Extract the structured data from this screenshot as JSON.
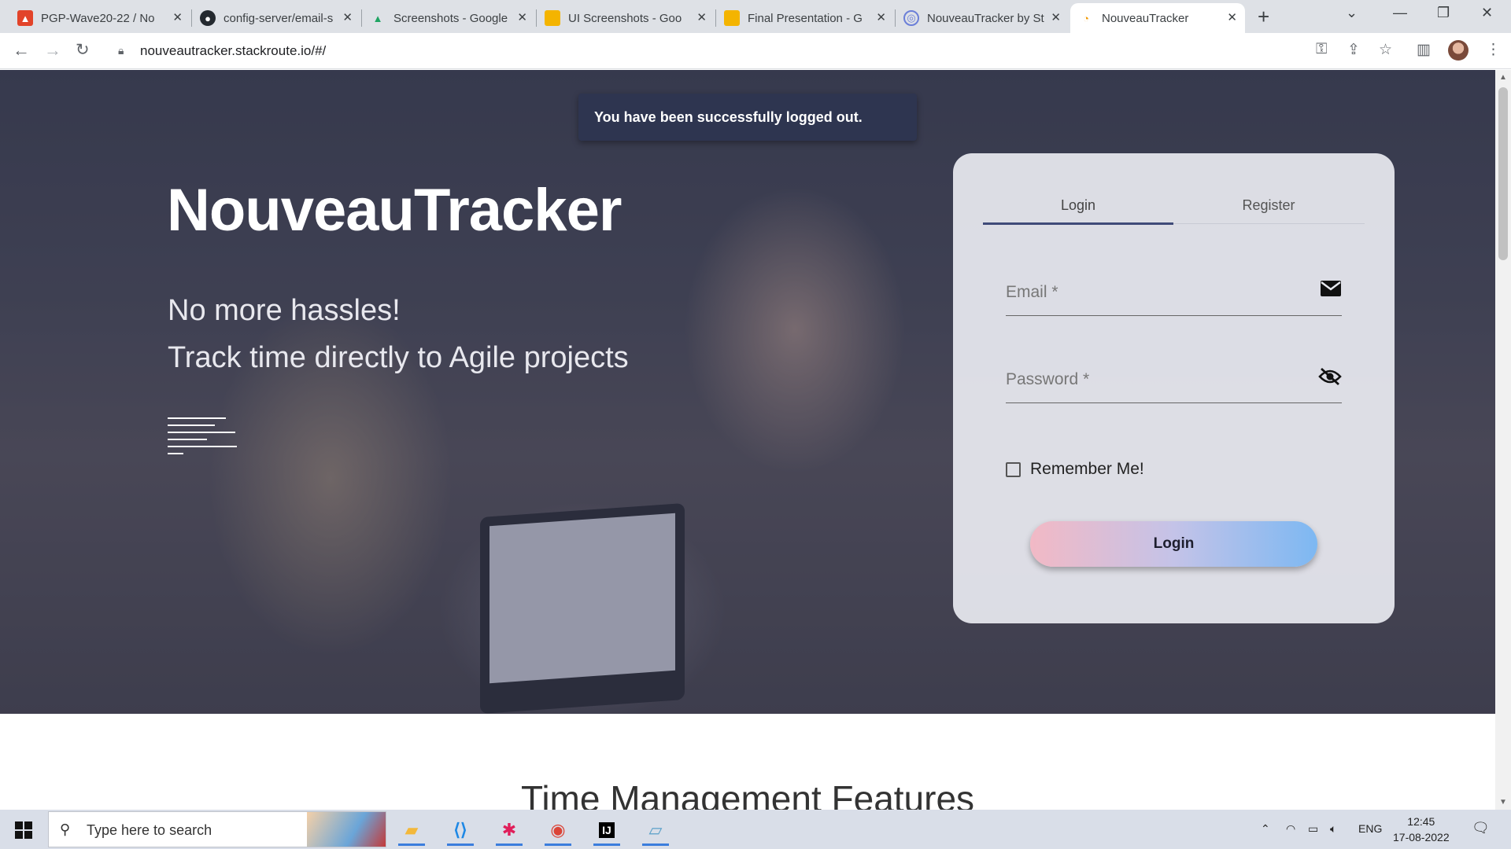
{
  "browser": {
    "tabs": [
      {
        "label": "PGP-Wave20-22 / No",
        "icon": "gitlab-icon",
        "color": "#e24329"
      },
      {
        "label": "config-server/email-s",
        "icon": "github-icon",
        "color": "#24292f"
      },
      {
        "label": "Screenshots - Google",
        "icon": "google-drive-icon",
        "color": "#1fa463"
      },
      {
        "label": "UI Screenshots - Goo",
        "icon": "google-slides-icon",
        "color": "#f4b400"
      },
      {
        "label": "Final Presentation - G",
        "icon": "google-slides-icon",
        "color": "#f4b400"
      },
      {
        "label": "NouveauTracker by St",
        "icon": "globe-icon",
        "color": "#6b7fd8"
      },
      {
        "label": "NouveauTracker",
        "icon": "loading-icon",
        "color": "#f29900"
      }
    ],
    "url": "nouveautracker.stackroute.io/#/"
  },
  "toast": {
    "message": "You have been successfully logged out."
  },
  "hero": {
    "brand": "NouveauTracker",
    "tagline_1": "No more hassles!",
    "tagline_2": "Track time directly to Agile projects"
  },
  "login_card": {
    "tabs": [
      "Login",
      "Register"
    ],
    "active_tab": "Login",
    "email_placeholder": "Email *",
    "email_value": "",
    "password_placeholder": "Password *",
    "password_value": "",
    "remember_label": "Remember Me!",
    "remember_checked": false,
    "login_button": "Login"
  },
  "features_heading": "Time Management Features",
  "taskbar": {
    "search_placeholder": "Type here to search",
    "apps": [
      "file-explorer-icon",
      "vscode-icon",
      "slack-icon",
      "chrome-icon",
      "intellij-icon",
      "notepad-icon"
    ],
    "language": "ENG",
    "time": "12:45",
    "date": "17-08-2022"
  },
  "colors": {
    "accent": "#3f4a78",
    "toast_bg": "#2e3550"
  }
}
